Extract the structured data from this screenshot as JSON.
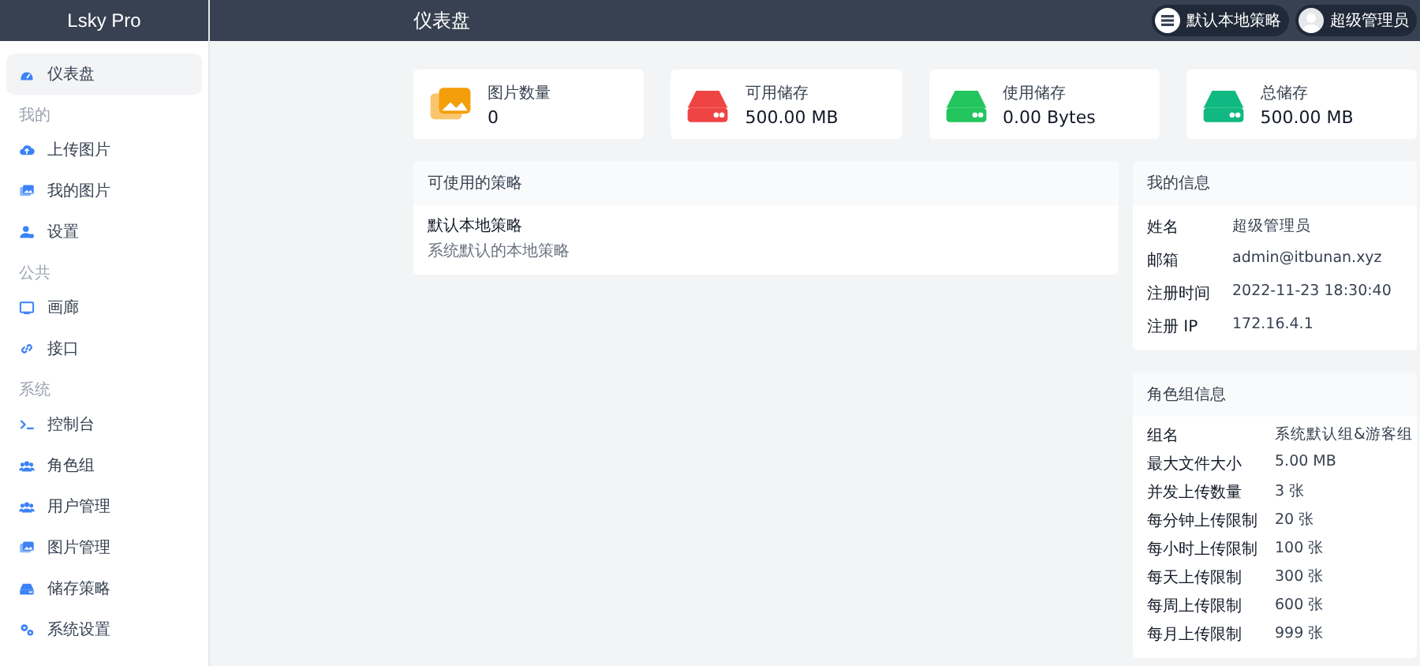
{
  "sidebar": {
    "brand": "Lsky Pro",
    "groups": [
      {
        "items": [
          {
            "label": "仪表盘",
            "kind": "dashboard",
            "selected": true
          }
        ]
      },
      {
        "title": "我的",
        "items": [
          {
            "label": "上传图片",
            "kind": "upload",
            "selected": false
          },
          {
            "label": "我的图片",
            "kind": "images",
            "selected": false
          },
          {
            "label": "设置",
            "kind": "user",
            "selected": false
          }
        ]
      },
      {
        "title": "公共",
        "items": [
          {
            "label": "画廊",
            "kind": "monitor",
            "selected": false
          },
          {
            "label": "接口",
            "kind": "link",
            "selected": false
          }
        ]
      },
      {
        "title": "系统",
        "items": [
          {
            "label": "控制台",
            "kind": "terminal",
            "selected": false
          },
          {
            "label": "角色组",
            "kind": "users",
            "selected": false
          },
          {
            "label": "用户管理",
            "kind": "users",
            "selected": false
          },
          {
            "label": "图片管理",
            "kind": "images",
            "selected": false
          },
          {
            "label": "储存策略",
            "kind": "drive",
            "selected": false
          },
          {
            "label": "系统设置",
            "kind": "gears",
            "selected": false
          }
        ]
      }
    ]
  },
  "header": {
    "title": "仪表盘",
    "strategy": "默认本地策略",
    "user": "超级管理员"
  },
  "stats": [
    {
      "label": "图片数量",
      "value": "0",
      "kind": "images",
      "color": "#f59e0b"
    },
    {
      "label": "可用储存",
      "value": "500.00 MB",
      "kind": "drive",
      "color": "#ef4444"
    },
    {
      "label": "使用储存",
      "value": "0.00 Bytes",
      "kind": "drive",
      "color": "#22c55e"
    },
    {
      "label": "总储存",
      "value": "500.00 MB",
      "kind": "drive",
      "color": "#10b981"
    }
  ],
  "strategies": {
    "title": "可使用的策略",
    "items": [
      {
        "name": "默认本地策略",
        "description": "系统默认的本地策略"
      }
    ]
  },
  "my_info": {
    "title": "我的信息",
    "rows": [
      {
        "key": "姓名",
        "value": "超级管理员"
      },
      {
        "key": "邮箱",
        "value": "admin@itbunan.xyz"
      },
      {
        "key": "注册时间",
        "value": "2022-11-23 18:30:40"
      },
      {
        "key": "注册 IP",
        "value": "172.16.4.1"
      }
    ]
  },
  "group_info": {
    "title": "角色组信息",
    "rows": [
      {
        "key": "组名",
        "value": "系统默认组&游客组"
      },
      {
        "key": "最大文件大小",
        "value": "5.00 MB"
      },
      {
        "key": "并发上传数量",
        "value": "3 张"
      },
      {
        "key": "每分钟上传限制",
        "value": "20 张"
      },
      {
        "key": "每小时上传限制",
        "value": "100 张"
      },
      {
        "key": "每天上传限制",
        "value": "300 张"
      },
      {
        "key": "每周上传限制",
        "value": "600 张"
      },
      {
        "key": "每月上传限制",
        "value": "999 张"
      }
    ]
  }
}
